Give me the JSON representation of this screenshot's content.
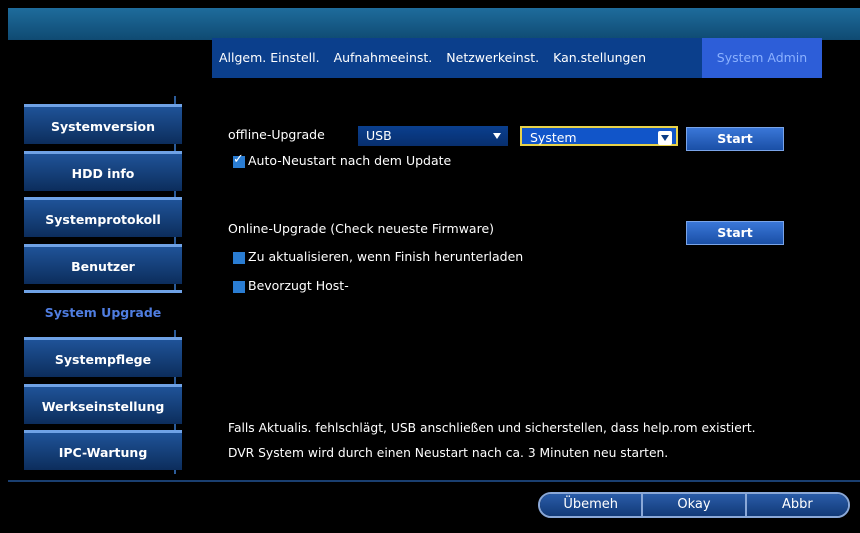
{
  "tabs": [
    {
      "label": "Allgem. Einstell."
    },
    {
      "label": "Aufnahmeeinst."
    },
    {
      "label": "Netzwerkeinst."
    },
    {
      "label": "Kan.stellungen"
    },
    {
      "label": "System Admin"
    }
  ],
  "sidebar": {
    "items": [
      {
        "label": "Systemversion"
      },
      {
        "label": "HDD info"
      },
      {
        "label": "Systemprotokoll"
      },
      {
        "label": "Benutzer"
      },
      {
        "label": "System Upgrade"
      },
      {
        "label": "Systempflege"
      },
      {
        "label": "Werkseinstellung"
      },
      {
        "label": "IPC-Wartung"
      }
    ]
  },
  "offline": {
    "label": "offline-Upgrade",
    "source": "USB",
    "target": "System",
    "start": "Start",
    "auto_restart": "Auto-Neustart nach dem Update",
    "auto_restart_checked": true
  },
  "online": {
    "label": "Online-Upgrade (Check neueste Firmware)",
    "start": "Start",
    "opt1": "Zu aktualisieren, wenn Finish herunterladen",
    "opt2": "Bevorzugt Host-"
  },
  "notes": {
    "line1": "Falls Aktualis. fehlschlägt, USB anschließen und sicherstellen, dass help.rom existiert.",
    "line2": "DVR System wird durch einen Neustart nach ca. 3 Minuten neu starten."
  },
  "footer": {
    "apply": "Übemeh",
    "ok": "Okay",
    "cancel": "Abbr"
  }
}
